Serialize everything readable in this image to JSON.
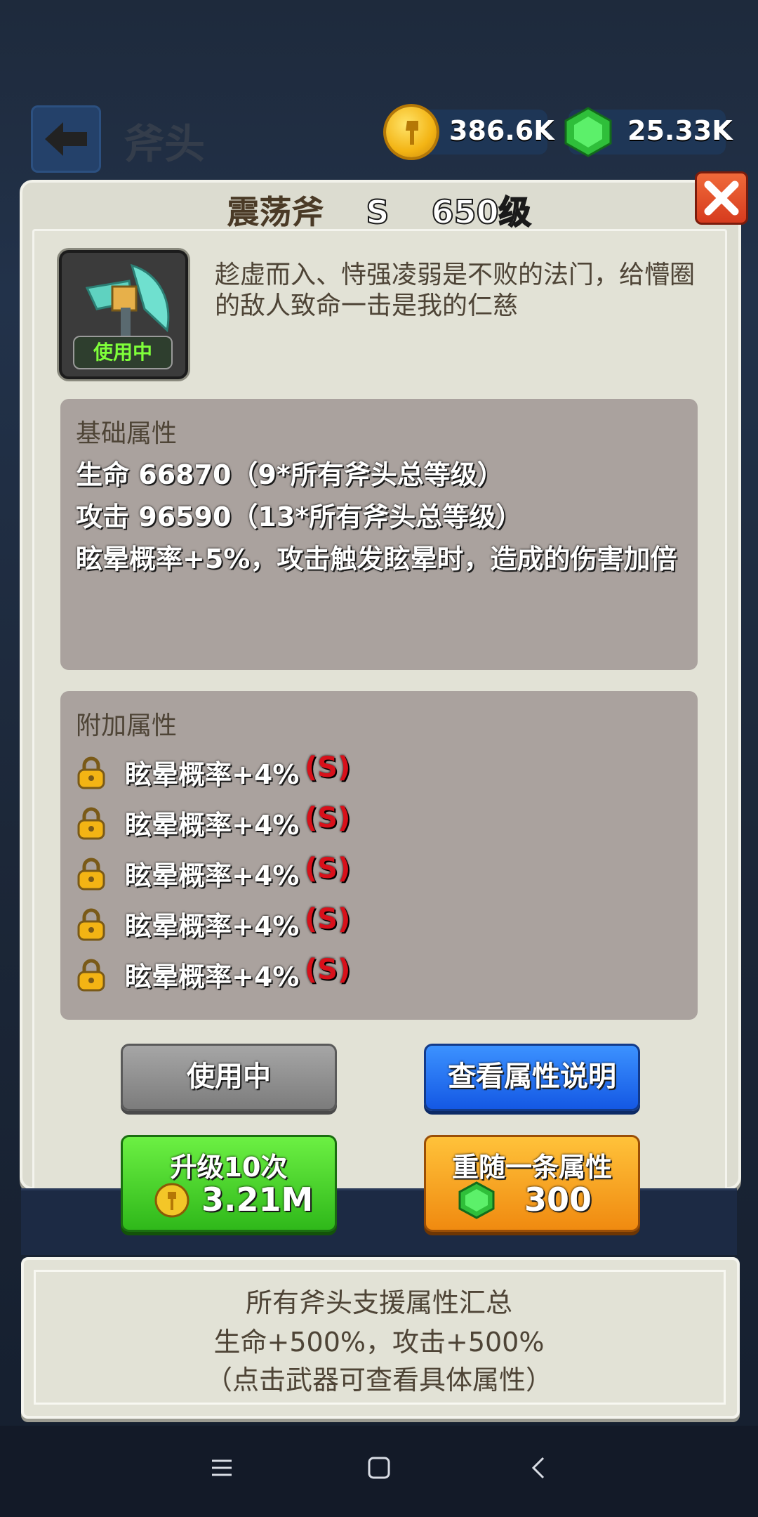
{
  "header": {
    "title": "斧头",
    "currencies": [
      {
        "name": "gold",
        "value": "386.6K"
      },
      {
        "name": "gem",
        "value": "25.33K"
      }
    ]
  },
  "item": {
    "name": "震荡斧",
    "rank": "S",
    "level": "650级",
    "badge": "使用中",
    "description": "趁虚而入、恃强凌弱是不败的法门，给懵圈的敌人致命一击是我的仁慈"
  },
  "base_attributes": {
    "title": "基础属性",
    "lines": [
      "生命 66870（9*所有斧头总等级）",
      "攻击 96590（13*所有斧头总等级）",
      "眩晕概率+5%，攻击触发眩晕时，造成的伤害加倍"
    ]
  },
  "extra_attributes": {
    "title": "附加属性",
    "rows": [
      {
        "text": "眩晕概率+4%",
        "grade": "(S)"
      },
      {
        "text": "眩晕概率+4%",
        "grade": "(S)"
      },
      {
        "text": "眩晕概率+4%",
        "grade": "(S)"
      },
      {
        "text": "眩晕概率+4%",
        "grade": "(S)"
      },
      {
        "text": "眩晕概率+4%",
        "grade": "(S)"
      }
    ]
  },
  "buttons": {
    "in_use": "使用中",
    "view_info": "查看属性说明",
    "upgrade_label": "升级10次",
    "upgrade_cost": "3.21M",
    "reroll_label": "重随一条属性",
    "reroll_cost": "300"
  },
  "summary": {
    "line1": "所有斧头支援属性汇总",
    "line2": "生命+500%，攻击+500%",
    "line3": "（点击武器可查看具体属性）"
  },
  "colors": {
    "gold": "#f3b414",
    "gem": "#39d94a",
    "grade_red": "#d8101a",
    "upgrade_green": "#2fb81a",
    "reroll_orange": "#f08a10",
    "info_blue": "#1458e4"
  }
}
